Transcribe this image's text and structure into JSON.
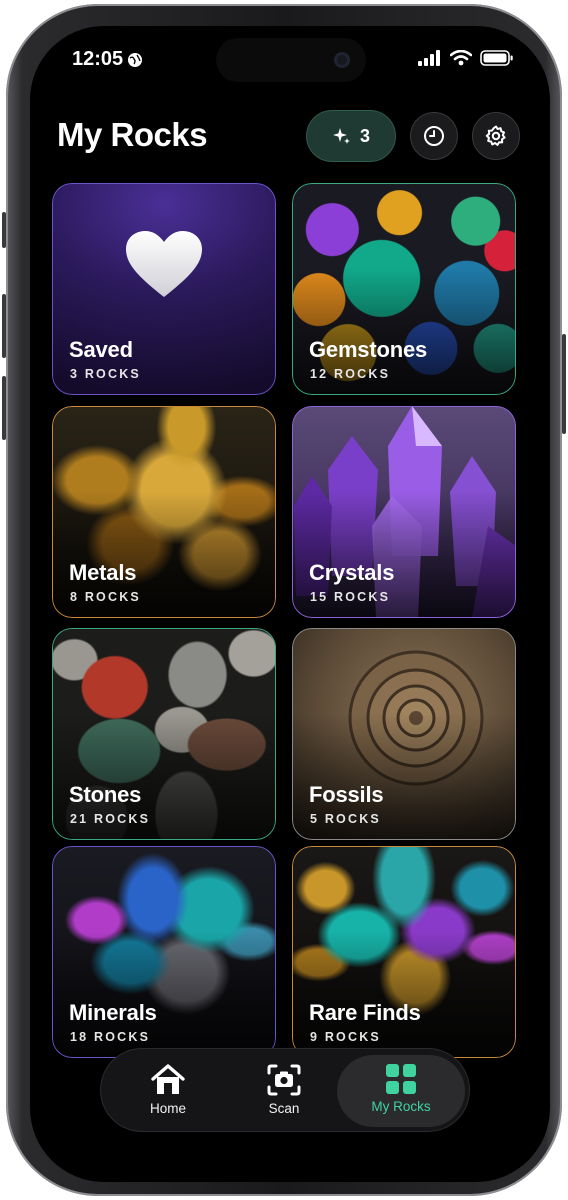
{
  "status_bar": {
    "time": "12:05"
  },
  "header": {
    "title": "My Rocks",
    "sparkle_count": "3"
  },
  "categories": [
    {
      "name": "Saved",
      "count": "3 ROCKS",
      "border": "#6b54c9"
    },
    {
      "name": "Gemstones",
      "count": "12 ROCKS",
      "border": "#3aa883"
    },
    {
      "name": "Metals",
      "count": "8 ROCKS",
      "border": "#c9893d"
    },
    {
      "name": "Crystals",
      "count": "15 ROCKS",
      "border": "#8a63d8"
    },
    {
      "name": "Stones",
      "count": "21 ROCKS",
      "border": "#3aa883"
    },
    {
      "name": "Fossils",
      "count": "5 ROCKS",
      "border": "#8a8a8a"
    },
    {
      "name": "Minerals",
      "count": "18 ROCKS",
      "border": "#6b54c9"
    },
    {
      "name": "Rare Finds",
      "count": "9 ROCKS",
      "border": "#c9893d"
    }
  ],
  "tabbar": {
    "items": [
      {
        "label": "Home",
        "icon": "home-icon"
      },
      {
        "label": "Scan",
        "icon": "scan-camera-icon"
      },
      {
        "label": "My Rocks",
        "icon": "grid-icon",
        "active": true
      }
    ]
  },
  "colors": {
    "accent": "#3fd3a0",
    "background": "#000000"
  }
}
